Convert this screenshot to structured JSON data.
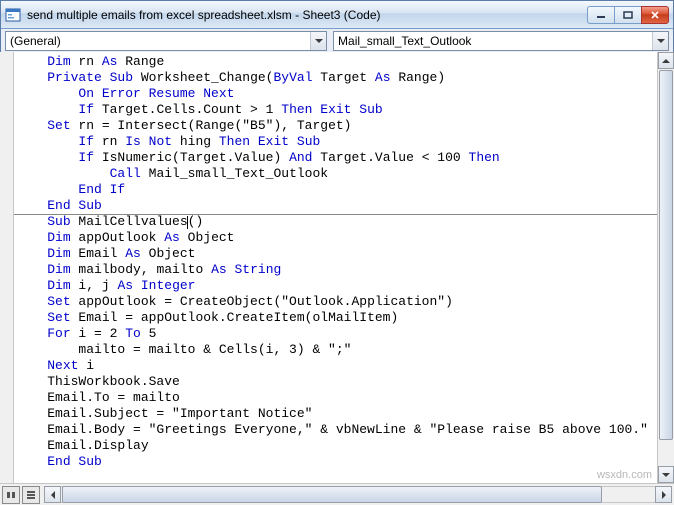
{
  "window": {
    "title": "send multiple emails from excel spreadsheet.xlsm - Sheet3 (Code)"
  },
  "dropdowns": {
    "object": "(General)",
    "procedure": "Mail_small_Text_Outlook"
  },
  "code": {
    "lines": [
      {
        "indent": 1,
        "tokens": [
          [
            "kw",
            "Dim"
          ],
          [
            "",
            " rn "
          ],
          [
            "kw",
            "As"
          ],
          [
            "",
            " Range"
          ]
        ]
      },
      {
        "indent": 1,
        "tokens": [
          [
            "kw",
            "Private Sub"
          ],
          [
            "",
            " Worksheet_Change("
          ],
          [
            "kw",
            "ByVal"
          ],
          [
            "",
            " Target "
          ],
          [
            "kw",
            "As"
          ],
          [
            "",
            " Range)"
          ]
        ]
      },
      {
        "indent": 2,
        "tokens": [
          [
            "kw",
            "On Error Resume Next"
          ]
        ]
      },
      {
        "indent": 2,
        "tokens": [
          [
            "kw",
            "If"
          ],
          [
            "",
            " Target.Cells.Count > 1 "
          ],
          [
            "kw",
            "Then Exit Sub"
          ]
        ]
      },
      {
        "indent": 1,
        "tokens": [
          [
            "kw",
            "Set"
          ],
          [
            "",
            " rn = Intersect(Range(\"B5\"), Target)"
          ]
        ]
      },
      {
        "indent": 2,
        "tokens": [
          [
            "kw",
            "If"
          ],
          [
            "",
            " rn "
          ],
          [
            "kw",
            "Is Not"
          ],
          [
            "",
            " hing "
          ],
          [
            "kw",
            "Then Exit Sub"
          ]
        ]
      },
      {
        "indent": 2,
        "tokens": [
          [
            "kw",
            "If"
          ],
          [
            "",
            " IsNumeric(Target.Value) "
          ],
          [
            "kw",
            "And"
          ],
          [
            "",
            " Target.Value < 100 "
          ],
          [
            "kw",
            "Then"
          ]
        ]
      },
      {
        "indent": 3,
        "tokens": [
          [
            "kw",
            "Call"
          ],
          [
            "",
            " Mail_small_Text_Outlook"
          ]
        ]
      },
      {
        "indent": 2,
        "tokens": [
          [
            "kw",
            "End If"
          ]
        ]
      },
      {
        "indent": 1,
        "tokens": [
          [
            "kw",
            "End Sub"
          ]
        ]
      },
      {
        "indent": 1,
        "divider_after": true,
        "caret_after_first": true,
        "tokens": [
          [
            "kw",
            "Sub"
          ],
          [
            "",
            " MailCellvalues"
          ],
          [
            "",
            "()"
          ]
        ]
      },
      {
        "indent": 1,
        "tokens": [
          [
            "kw",
            "Dim"
          ],
          [
            "",
            " appOutlook "
          ],
          [
            "kw",
            "As"
          ],
          [
            "",
            " Object"
          ]
        ]
      },
      {
        "indent": 1,
        "tokens": [
          [
            "kw",
            "Dim"
          ],
          [
            "",
            " Email "
          ],
          [
            "kw",
            "As"
          ],
          [
            "",
            " Object"
          ]
        ]
      },
      {
        "indent": 1,
        "tokens": [
          [
            "kw",
            "Dim"
          ],
          [
            "",
            " mailbody, mailto "
          ],
          [
            "kw",
            "As"
          ],
          [
            "",
            " "
          ],
          [
            "kw",
            "String"
          ]
        ]
      },
      {
        "indent": 1,
        "tokens": [
          [
            "kw",
            "Dim"
          ],
          [
            "",
            " i, j "
          ],
          [
            "kw",
            "As"
          ],
          [
            "",
            " "
          ],
          [
            "kw",
            "Integer"
          ]
        ]
      },
      {
        "indent": 1,
        "tokens": [
          [
            "kw",
            "Set"
          ],
          [
            "",
            " appOutlook = CreateObject(\"Outlook.Application\")"
          ]
        ]
      },
      {
        "indent": 1,
        "tokens": [
          [
            "kw",
            "Set"
          ],
          [
            "",
            " Email = appOutlook.CreateItem(olMailItem)"
          ]
        ]
      },
      {
        "indent": 1,
        "tokens": [
          [
            "kw",
            "For"
          ],
          [
            "",
            " i = 2 "
          ],
          [
            "kw",
            "To"
          ],
          [
            "",
            " 5"
          ]
        ]
      },
      {
        "indent": 2,
        "tokens": [
          [
            "",
            "mailto = mailto & Cells(i, 3) & \";\""
          ]
        ]
      },
      {
        "indent": 1,
        "tokens": [
          [
            "kw",
            "Next"
          ],
          [
            "",
            " i"
          ]
        ]
      },
      {
        "indent": 1,
        "tokens": [
          [
            "",
            "ThisWorkbook.Save"
          ]
        ]
      },
      {
        "indent": 1,
        "tokens": [
          [
            "",
            "Email.To = mailto"
          ]
        ]
      },
      {
        "indent": 1,
        "tokens": [
          [
            "",
            "Email.Subject = \"Important Notice\""
          ]
        ]
      },
      {
        "indent": 1,
        "tokens": [
          [
            "",
            "Email.Body = \"Greetings Everyone,\" & vbNewLine & \"Please raise B5 above 100.\""
          ]
        ]
      },
      {
        "indent": 1,
        "tokens": [
          [
            "",
            "Email.Display"
          ]
        ]
      },
      {
        "indent": 1,
        "tokens": [
          [
            "kw",
            "End Sub"
          ]
        ]
      }
    ],
    "divider_before_line": 10
  },
  "watermark": "wsxdn.com"
}
